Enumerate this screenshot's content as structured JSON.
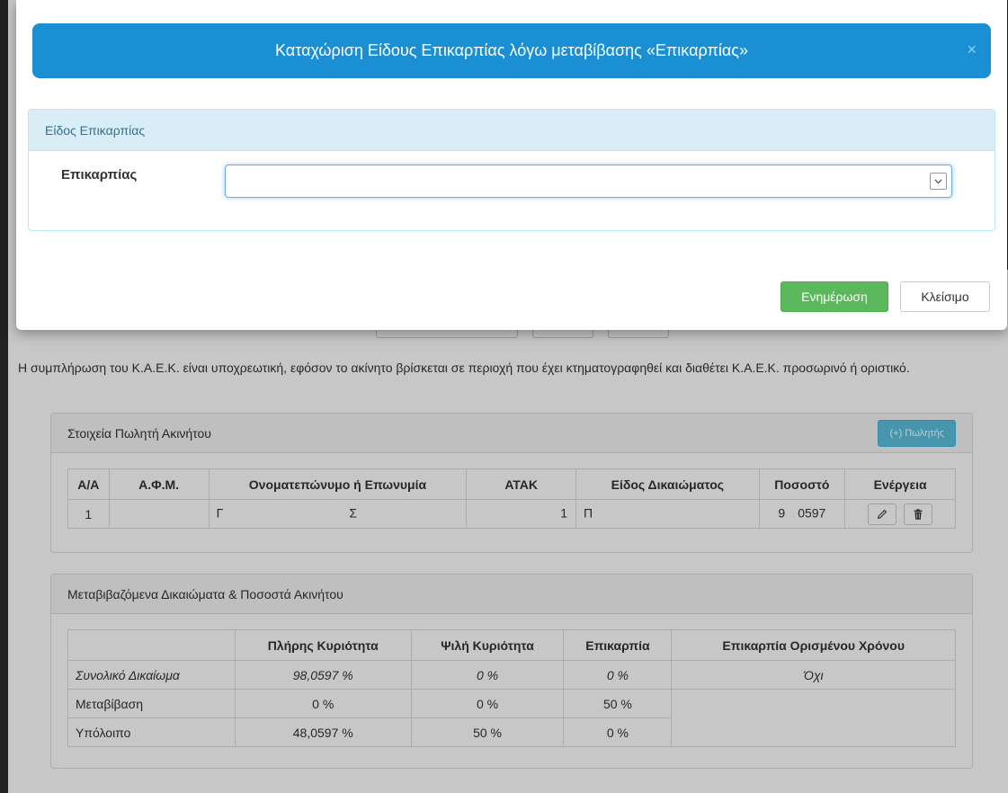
{
  "modal": {
    "title": "Καταχώριση Είδους Επικαρπίας λόγω μεταβίβασης «Επικαρπίας»",
    "close_symbol": "×",
    "section_title": "Είδος Επικαρπίας",
    "field_label": "Επικαρπίας",
    "field_value": "",
    "update_label": "Ενημέρωση",
    "close_label": "Κλείσιμο"
  },
  "notice": "Η συμπλήρωση του Κ.Α.Ε.Κ. είναι υποχρεωτική, εφόσον το ακίνητο βρίσκεται σε περιοχή που έχει κτηματογραφηθεί και διαθέτει Κ.Α.Ε.Κ. προσωρινό ή οριστικό.",
  "sellers": {
    "title": "Στοιχεία Πωλητή Ακινήτου",
    "add_label": "(+) Πωλητής",
    "headers": [
      "Α/Α",
      "Α.Φ.Μ.",
      "Ονοματεπώνυμο ή Επωνυμία",
      "ΑΤΑΚ",
      "Είδος Δικαιώματος",
      "Ποσοστό",
      "Ενέργεια"
    ],
    "rows": [
      {
        "aa": "1",
        "name_prefix": "Γ",
        "name_suffix": "Σ",
        "atak_suffix": "1",
        "right_prefix": "Π",
        "pct_prefix": "9",
        "pct_suffix": "0597"
      }
    ]
  },
  "rights": {
    "title": "Μεταβιβαζόμενα Δικαιώματα & Ποσοστά Ακινήτου",
    "headers": [
      "",
      "Πλήρης Κυριότητα",
      "Ψιλή Κυριότητα",
      "Επικαρπία",
      "Επικαρπία Ορισμένου Χρόνου"
    ],
    "rows": [
      {
        "label": "Συνολικό Δικαίωμα",
        "full": "98,0597 %",
        "bare": "0 %",
        "usufruct": "0 %",
        "fixed": "Όχι"
      },
      {
        "label": "Μεταβίβαση",
        "full": "0 %",
        "bare": "0 %",
        "usufruct": "50 %",
        "fixed": ""
      },
      {
        "label": "Υπόλοιπο",
        "full": "48,0597 %",
        "bare": "50 %",
        "usufruct": "0 %",
        "fixed": ""
      }
    ]
  },
  "icons": {
    "edit": "pencil-icon",
    "delete": "trash-icon",
    "dropdown": "chevron-down-icon"
  }
}
